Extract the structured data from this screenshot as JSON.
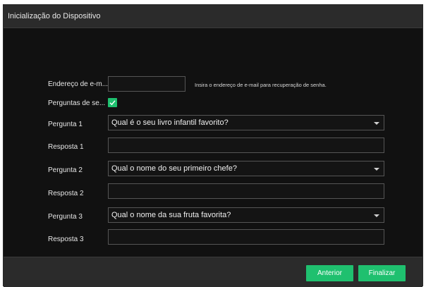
{
  "dialog": {
    "title": "Inicialização do Dispositivo"
  },
  "form": {
    "email": {
      "label": "Endereço de e-m...",
      "value": "",
      "hint": "Insira o endereço de e-mail para recuperação de senha."
    },
    "security_questions": {
      "label": "Perguntas de se...",
      "checked": true
    },
    "question1": {
      "label": "Pergunta 1",
      "selected": "Qual é o seu livro infantil favorito?"
    },
    "answer1": {
      "label": "Resposta 1",
      "value": ""
    },
    "question2": {
      "label": "Pergunta 2",
      "selected": "Qual o nome do seu primeiro chefe?"
    },
    "answer2": {
      "label": "Resposta 2",
      "value": ""
    },
    "question3": {
      "label": "Pergunta 3",
      "selected": "Qual o nome da sua fruta favorita?"
    },
    "answer3": {
      "label": "Resposta 3",
      "value": ""
    }
  },
  "footer": {
    "back_label": "Anterior",
    "finish_label": "Finalizar"
  },
  "colors": {
    "accent": "#1fc06f",
    "background": "#111111",
    "bar": "#2b2b2b"
  },
  "icons": {
    "checkbox": "checkmark-icon",
    "dropdown": "chevron-down-icon"
  }
}
